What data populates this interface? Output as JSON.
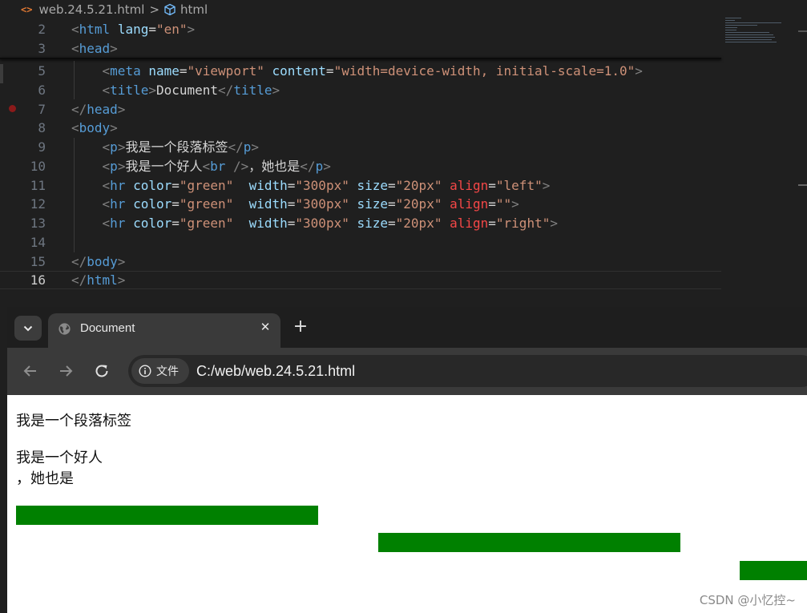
{
  "editor": {
    "breadcrumb": {
      "file_icon": "<>",
      "file": "web.24.5.21.html",
      "separator": ">",
      "element": "html"
    },
    "lines": [
      {
        "num": "2",
        "text": "<html lang=\"en\">"
      },
      {
        "num": "3",
        "text": "<head>"
      },
      {
        "num": "5",
        "text": "    <meta name=\"viewport\" content=\"width=device-width, initial-scale=1.0\">"
      },
      {
        "num": "6",
        "text": "    <title>Document</title>"
      },
      {
        "num": "7",
        "text": "</head>"
      },
      {
        "num": "8",
        "text": "<body>"
      },
      {
        "num": "9",
        "text": "    <p>我是一个段落标签</p>"
      },
      {
        "num": "10",
        "text": "    <p>我是一个好人<br />，她也是</p>"
      },
      {
        "num": "11",
        "text": "    <hr color=\"green\"  width=\"300px\" size=\"20px\" align=\"left\">"
      },
      {
        "num": "12",
        "text": "    <hr color=\"green\"  width=\"300px\" size=\"20px\" align=\"\">"
      },
      {
        "num": "13",
        "text": "    <hr color=\"green\"  width=\"300px\" size=\"20px\" align=\"right\">"
      },
      {
        "num": "14",
        "text": ""
      },
      {
        "num": "15",
        "text": "</body>"
      },
      {
        "num": "16",
        "text": "</html>"
      }
    ]
  },
  "browser": {
    "tab": {
      "title": "Document",
      "close": "✕",
      "icon": "globe-icon"
    },
    "new_tab": "+",
    "nav": {
      "back": "back-arrow-icon",
      "forward": "forward-arrow-icon",
      "reload": "reload-icon"
    },
    "site_chip": {
      "label": "文件",
      "icon": "info-icon"
    },
    "url": "C:/web/web.24.5.21.html",
    "page": {
      "p1": "我是一个段落标签",
      "p2_line1": "我是一个好人",
      "p2_line2": "，她也是",
      "hr_color": "#008000"
    }
  },
  "watermark": "CSDN @小忆控~"
}
